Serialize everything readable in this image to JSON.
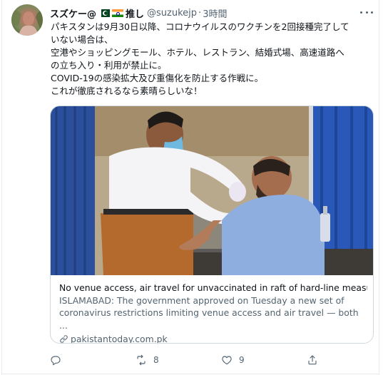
{
  "tweet": {
    "author": {
      "display_name": "スズケー@",
      "name_suffix": "推し",
      "handle": "@suzukejp",
      "time": "3時間"
    },
    "text_lines": [
      "パキスタンは9月30日以降、コロナウイルスのワクチンを2回接種完了して",
      "いない場合は、",
      "空港やショッピングモール、ホテル、レストラン、結婚式場、高速道路へ",
      "の立ち入り・利用が禁止に。",
      "COVID-19の感染拡大及び重傷化を防止する作戦に。",
      "これが徹底されるなら素晴らしいな！"
    ],
    "card": {
      "title": "No venue access, air travel for unvaccinated in raft of hard-line measur...",
      "description_lines": [
        "ISLAMABAD: The government approved on Tuesday a new set of",
        "coronavirus restrictions limiting venue access and air travel — both ..."
      ],
      "domain": "pakistantoday.com.pk"
    },
    "actions": {
      "reply_count": "",
      "retweet_count": "8",
      "like_count": "9",
      "share_count": ""
    }
  },
  "icons": {
    "more": "more-horizontal-icon",
    "reply": "reply-icon",
    "retweet": "retweet-icon",
    "like": "heart-icon",
    "share": "share-icon",
    "link": "link-icon"
  }
}
